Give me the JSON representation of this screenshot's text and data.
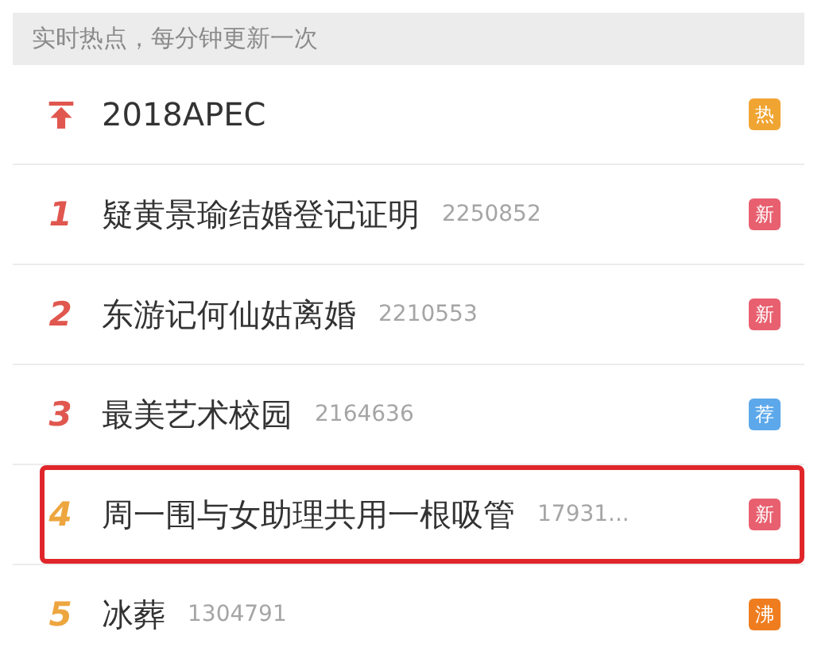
{
  "header": {
    "text": "实时热点，每分钟更新一次"
  },
  "items": [
    {
      "kind": "pinned",
      "title": "2018APEC",
      "badge": {
        "text": "热",
        "color": "#f0a533"
      },
      "highlighted": false
    },
    {
      "kind": "ranked",
      "rank": "1",
      "title": "疑黄景瑜结婚登记证明",
      "count": "2250852",
      "badge": {
        "text": "新",
        "color": "#e8606f"
      },
      "highlighted": false
    },
    {
      "kind": "ranked",
      "rank": "2",
      "title": "东游记何仙姑离婚",
      "count": "2210553",
      "badge": {
        "text": "新",
        "color": "#e8606f"
      },
      "highlighted": false
    },
    {
      "kind": "ranked",
      "rank": "3",
      "title": "最美艺术校园",
      "count": "2164636",
      "badge": {
        "text": "荐",
        "color": "#5ca8ea"
      },
      "highlighted": false
    },
    {
      "kind": "ranked",
      "rank": "4",
      "title": "周一围与女助理共用一根吸管",
      "count": "17931...",
      "badge": {
        "text": "新",
        "color": "#e8606f"
      },
      "highlighted": true
    },
    {
      "kind": "ranked",
      "rank": "5",
      "title": "冰葬",
      "count": "1304791",
      "badge": {
        "text": "沸",
        "color": "#ef7d1f"
      },
      "highlighted": false
    }
  ]
}
